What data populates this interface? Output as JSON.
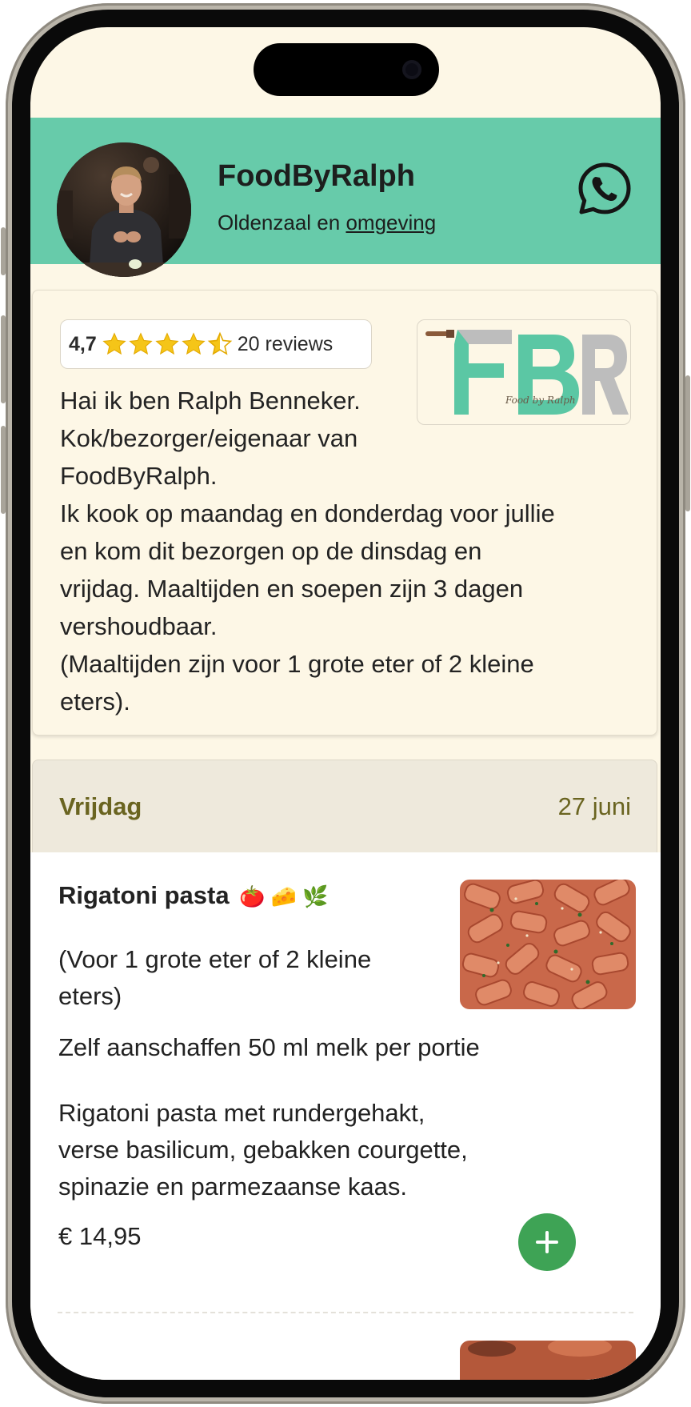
{
  "header": {
    "name": "FoodByRalph",
    "location_prefix": "Oldenzaal en ",
    "location_link": "omgeving",
    "whatsapp_icon": "whatsapp-icon",
    "accent_color": "#67cbaa"
  },
  "rating": {
    "value": "4,7",
    "stars": 4.7,
    "reviews": "20 reviews"
  },
  "logo": {
    "text": "FBR",
    "tagline": "Food by Ralph"
  },
  "bio": {
    "lines": [
      "Hai ik ben Ralph Benneker.",
      "Kok/bezorger/eigenaar van",
      "FoodByRalph.",
      "Ik kook op maandag en donderdag voor jullie",
      "en kom dit bezorgen op de dinsdag en",
      "vrijdag. Maaltijden en soepen zijn 3 dagen",
      "vershoudbaar.",
      "(Maaltijden zijn voor 1 grote eter of 2 kleine",
      "eters)."
    ]
  },
  "day": {
    "name": "Vrijdag",
    "date": "27 juni"
  },
  "dish": {
    "title": "Rigatoni pasta",
    "emojis": "🍅 🧀 🌿",
    "portion": "(Voor 1 grote eter of 2 kleine eters)",
    "extra": "Zelf aanschaffen 50 ml melk per portie",
    "description": [
      "Rigatoni pasta met rundergehakt,",
      "verse basilicum, gebakken courgette,",
      "spinazie en parmezaanse kaas."
    ],
    "price": "€ 14,95",
    "add_icon": "plus-icon",
    "add_color": "#3ea355"
  }
}
